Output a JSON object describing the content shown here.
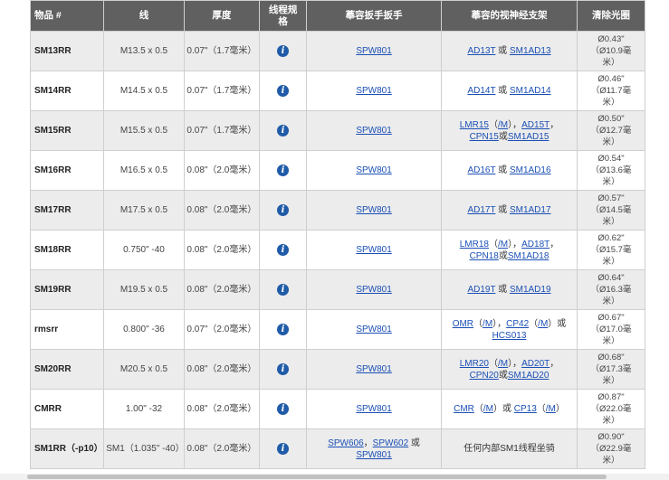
{
  "headers": {
    "item": "物品 #",
    "thread": "线",
    "thickness": "厚度",
    "thread_spec_line1": "线程规",
    "thread_spec_line2": "格",
    "wrench": "菶容扳手扳手",
    "collet": "菶容的视神经支架",
    "clearance": "清除光圈"
  },
  "rows": [
    {
      "item": "SM13RR",
      "thread": "M13.5 x 0.5",
      "thickness": "0.07\"（1.7毫米）",
      "wrench": [
        {
          "t": "SPW801",
          "l": true
        }
      ],
      "collet": [
        [
          {
            "t": "AD13T",
            "l": true
          },
          {
            "t": " 或 ",
            "l": false
          },
          {
            "t": "SM1AD13",
            "l": true
          }
        ]
      ],
      "clear": [
        "Ø0.43\"",
        "（Ø10.9毫",
        "米）"
      ]
    },
    {
      "item": "SM14RR",
      "thread": "M14.5 x 0.5",
      "thickness": "0.07\"（1.7毫米）",
      "wrench": [
        {
          "t": "SPW801",
          "l": true
        }
      ],
      "collet": [
        [
          {
            "t": "AD14T",
            "l": true
          },
          {
            "t": " 或 ",
            "l": false
          },
          {
            "t": "SM1AD14",
            "l": true
          }
        ]
      ],
      "clear": [
        "Ø0.46\"",
        "（Ø11.7毫",
        "米）"
      ]
    },
    {
      "item": "SM15RR",
      "thread": "M15.5 x 0.5",
      "thickness": "0.07\"（1.7毫米）",
      "wrench": [
        {
          "t": "SPW801",
          "l": true
        }
      ],
      "collet": [
        [
          {
            "t": "LMR15",
            "l": true
          },
          {
            "t": "（",
            "l": false
          },
          {
            "t": "/M",
            "l": true
          },
          {
            "t": "），",
            "l": false
          },
          {
            "t": "AD15T",
            "l": true
          },
          {
            "t": "，",
            "l": false
          }
        ],
        [
          {
            "t": "CPN15",
            "l": true
          },
          {
            "t": "或",
            "l": false
          },
          {
            "t": "SM1AD15",
            "l": true
          }
        ]
      ],
      "clear": [
        "Ø0.50\"",
        "（Ø12.7毫",
        "米）"
      ]
    },
    {
      "item": "SM16RR",
      "thread": "M16.5 x 0.5",
      "thickness": "0.08\"（2.0毫米）",
      "wrench": [
        {
          "t": "SPW801",
          "l": true
        }
      ],
      "collet": [
        [
          {
            "t": "AD16T",
            "l": true
          },
          {
            "t": " 或 ",
            "l": false
          },
          {
            "t": "SM1AD16",
            "l": true
          }
        ]
      ],
      "clear": [
        "Ø0.54\"",
        "（Ø13.6毫",
        "米）"
      ]
    },
    {
      "item": "SM17RR",
      "thread": "M17.5 x 0.5",
      "thickness": "0.08\"（2.0毫米）",
      "wrench": [
        {
          "t": "SPW801",
          "l": true
        }
      ],
      "collet": [
        [
          {
            "t": "AD17T",
            "l": true
          },
          {
            "t": " 或 ",
            "l": false
          },
          {
            "t": "SM1AD17",
            "l": true
          }
        ]
      ],
      "clear": [
        "Ø0.57\"",
        "（Ø14.5毫",
        "米）"
      ]
    },
    {
      "item": "SM18RR",
      "thread": "0.750\" -40",
      "thickness": "0.08\"（2.0毫米）",
      "wrench": [
        {
          "t": "SPW801",
          "l": true
        }
      ],
      "collet": [
        [
          {
            "t": "LMR18",
            "l": true
          },
          {
            "t": "（",
            "l": false
          },
          {
            "t": "/M",
            "l": true
          },
          {
            "t": "），",
            "l": false
          },
          {
            "t": "AD18T",
            "l": true
          },
          {
            "t": "，",
            "l": false
          }
        ],
        [
          {
            "t": "CPN18",
            "l": true
          },
          {
            "t": "或",
            "l": false
          },
          {
            "t": "SM1AD18",
            "l": true
          }
        ]
      ],
      "clear": [
        "Ø0.62\"",
        "（Ø15.7毫",
        "米）"
      ]
    },
    {
      "item": "SM19RR",
      "thread": "M19.5 x 0.5",
      "thickness": "0.08\"（2.0毫米）",
      "wrench": [
        {
          "t": "SPW801",
          "l": true
        }
      ],
      "collet": [
        [
          {
            "t": "AD19T",
            "l": true
          },
          {
            "t": " 或 ",
            "l": false
          },
          {
            "t": "SM1AD19",
            "l": true
          }
        ]
      ],
      "clear": [
        "Ø0.64\"",
        "（Ø16.3毫",
        "米）"
      ]
    },
    {
      "item": "rmsrr",
      "thread": "0.800\" -36",
      "thickness": "0.07\"（2.0毫米）",
      "wrench": [
        {
          "t": "SPW801",
          "l": true
        }
      ],
      "collet": [
        [
          {
            "t": "OMR",
            "l": true
          },
          {
            "t": "（",
            "l": false
          },
          {
            "t": "/M",
            "l": true
          },
          {
            "t": "），",
            "l": false
          },
          {
            "t": "CP42",
            "l": true
          },
          {
            "t": "（",
            "l": false
          },
          {
            "t": "/M",
            "l": true
          },
          {
            "t": "）或",
            "l": false
          }
        ],
        [
          {
            "t": "HCS013",
            "l": true
          }
        ]
      ],
      "clear": [
        "Ø0.67\"",
        "（Ø17.0毫",
        "米）"
      ]
    },
    {
      "item": "SM20RR",
      "thread": "M20.5 x 0.5",
      "thickness": "0.08\"（2.0毫米）",
      "wrench": [
        {
          "t": "SPW801",
          "l": true
        }
      ],
      "collet": [
        [
          {
            "t": "LMR20",
            "l": true
          },
          {
            "t": "（",
            "l": false
          },
          {
            "t": "/M",
            "l": true
          },
          {
            "t": "），",
            "l": false
          },
          {
            "t": "AD20T",
            "l": true
          },
          {
            "t": "，",
            "l": false
          }
        ],
        [
          {
            "t": "CPN20",
            "l": true
          },
          {
            "t": "或",
            "l": false
          },
          {
            "t": "SM1AD20",
            "l": true
          }
        ]
      ],
      "clear": [
        "Ø0.68\"",
        "（Ø17.3毫",
        "米）"
      ]
    },
    {
      "item": "CMRR",
      "thread": "1.00\" -32",
      "thickness": "0.08\"（2.0毫米）",
      "wrench": [
        {
          "t": "SPW801",
          "l": true
        }
      ],
      "collet": [
        [
          {
            "t": "CMR",
            "l": true
          },
          {
            "t": "（",
            "l": false
          },
          {
            "t": "/M",
            "l": true
          },
          {
            "t": "）或 ",
            "l": false
          },
          {
            "t": "CP13",
            "l": true
          },
          {
            "t": "（",
            "l": false
          },
          {
            "t": "/M",
            "l": true
          },
          {
            "t": "）",
            "l": false
          }
        ]
      ],
      "clear": [
        "Ø0.87\"",
        "（Ø22.0毫",
        "米）"
      ]
    },
    {
      "item": "SM1RR（-p10）",
      "thread": "SM1（1.035\" -40）",
      "thickness": "0.08\"（2.0毫米）",
      "wrench": [
        {
          "t": "SPW606",
          "l": true
        },
        {
          "t": "，",
          "l": false
        },
        {
          "t": "SPW602",
          "l": true
        },
        {
          "t": " 或 ",
          "l": false
        },
        {
          "t": "SPW801",
          "l": true
        }
      ],
      "collet": [
        [
          {
            "t": "任何内部SM1线程坐骑",
            "l": false
          }
        ]
      ],
      "clear": [
        "Ø0.90\"",
        "（Ø22.9毫",
        "米）"
      ]
    }
  ]
}
